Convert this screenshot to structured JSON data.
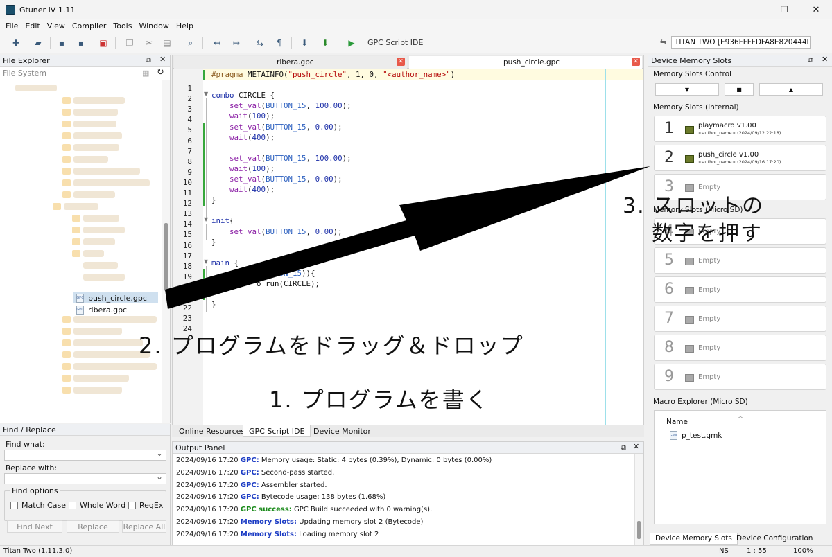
{
  "window": {
    "title": "Gtuner IV 1.11",
    "controls": [
      "—",
      "☐",
      "✕"
    ]
  },
  "menu": [
    "File",
    "Edit",
    "View",
    "Compiler",
    "Tools",
    "Window",
    "Help"
  ],
  "toolbar": {
    "gpc_ide_label": "GPC Script IDE",
    "device": "TITAN TWO [E936FFFFDFA8E820444D"
  },
  "file_explorer": {
    "title": "File Explorer",
    "filesystem_label": "File System",
    "files": [
      {
        "name": "push_circle.gpc",
        "selected": true
      },
      {
        "name": "ribera.gpc",
        "selected": false
      }
    ]
  },
  "find_replace": {
    "title": "Find / Replace",
    "find_what": "Find what:",
    "replace_with": "Replace with:",
    "options_title": "Find options",
    "options": [
      "Match Case",
      "Whole Word",
      "RegEx"
    ],
    "buttons": [
      "Find Next",
      "Replace",
      "Replace All"
    ]
  },
  "editor": {
    "tabs": [
      {
        "name": "ribera.gpc",
        "active": false
      },
      {
        "name": "push_circle.gpc",
        "active": true
      }
    ],
    "lines": [
      {
        "n": "1",
        "code": "#pragma METAINFO(\"push_circle\", 1, 0, \"<author_name>\")"
      },
      {
        "n": "2",
        "code": ""
      },
      {
        "n": "3",
        "code": "combo CIRCLE {"
      },
      {
        "n": "4",
        "code": "    set_val(BUTTON_15, 100.00);"
      },
      {
        "n": "5",
        "code": "    wait(100);"
      },
      {
        "n": "6",
        "code": "    set_val(BUTTON_15, 0.00);"
      },
      {
        "n": "7",
        "code": "    wait(400);"
      },
      {
        "n": "8",
        "code": ""
      },
      {
        "n": "9",
        "code": "    set_val(BUTTON_15, 100.00);"
      },
      {
        "n": "10",
        "code": "    wait(100);"
      },
      {
        "n": "11",
        "code": "    set_val(BUTTON_15, 0.00);"
      },
      {
        "n": "12",
        "code": "    wait(400);"
      },
      {
        "n": "13",
        "code": "}"
      },
      {
        "n": "14",
        "code": ""
      },
      {
        "n": "15",
        "code": "init{"
      },
      {
        "n": "16",
        "code": "    set_val(BUTTON_15, 0.00);"
      },
      {
        "n": "17",
        "code": "}"
      },
      {
        "n": "18",
        "code": ""
      },
      {
        "n": "19",
        "code": "main {"
      },
      {
        "n": "20",
        "code": "          (BUTTON_15)){"
      },
      {
        "n": "21",
        "code": "          o_run(CIRCLE);"
      },
      {
        "n": "22",
        "code": ""
      },
      {
        "n": "23",
        "code": "}"
      },
      {
        "n": "24",
        "code": ""
      }
    ],
    "bottom_tabs": [
      {
        "name": "Online Resources",
        "active": false
      },
      {
        "name": "GPC Script IDE",
        "active": true
      },
      {
        "name": "Device Monitor",
        "active": false
      }
    ]
  },
  "output": {
    "title": "Output Panel",
    "lines": [
      {
        "ts": "2024/09/16 17:20",
        "tag": "GPC:",
        "kind": "tag",
        "msg": "Memory usage: Static: 4 bytes (0.39%), Dynamic: 0 bytes (0.00%)"
      },
      {
        "ts": "2024/09/16 17:20",
        "tag": "GPC:",
        "kind": "tag",
        "msg": "Second-pass started."
      },
      {
        "ts": "2024/09/16 17:20",
        "tag": "GPC:",
        "kind": "tag",
        "msg": "Assembler started."
      },
      {
        "ts": "2024/09/16 17:20",
        "tag": "GPC:",
        "kind": "tag",
        "msg": "Bytecode usage: 138 bytes (1.68%)"
      },
      {
        "ts": "2024/09/16 17:20",
        "tag": "GPC success:",
        "kind": "ok",
        "msg": "GPC Build succeeded with 0 warning(s)."
      },
      {
        "ts": "2024/09/16 17:20",
        "tag": "Memory Slots:",
        "kind": "tag",
        "msg": "Updating memory slot 2 (Bytecode)"
      },
      {
        "ts": "2024/09/16 17:20",
        "tag": "Memory Slots:",
        "kind": "tag",
        "msg": "Loading memory slot 2"
      }
    ]
  },
  "device_memory": {
    "title": "Device Memory Slots",
    "control_label": "Memory Slots Control",
    "control_buttons": [
      "▼",
      "■",
      "▲"
    ],
    "internal_label": "Memory Slots (Internal)",
    "microsd_label": "Memory Slots (Micro SD)",
    "slots": [
      {
        "n": "1",
        "name": "playmacro v1.00",
        "meta": "<author_name> (2024/09/12 22:18)",
        "empty": false
      },
      {
        "n": "2",
        "name": "push_circle v1.00",
        "meta": "<author_name> (2024/09/16 17:20)",
        "empty": false
      },
      {
        "n": "3",
        "name": "Empty",
        "meta": "",
        "empty": true
      },
      {
        "n": "4",
        "name": "Empty",
        "meta": "",
        "empty": true
      },
      {
        "n": "5",
        "name": "Empty",
        "meta": "",
        "empty": true
      },
      {
        "n": "6",
        "name": "Empty",
        "meta": "",
        "empty": true
      },
      {
        "n": "7",
        "name": "Empty",
        "meta": "",
        "empty": true
      },
      {
        "n": "8",
        "name": "Empty",
        "meta": "",
        "empty": true
      },
      {
        "n": "9",
        "name": "Empty",
        "meta": "",
        "empty": true
      }
    ],
    "macro_label": "Macro Explorer (Micro SD)",
    "macro_column": "Name",
    "macro_files": [
      "p_test.gmk"
    ],
    "tabs": [
      {
        "name": "Device Memory Slots",
        "active": true
      },
      {
        "name": "Device Configuration",
        "active": false
      }
    ]
  },
  "status": {
    "app": "Titan Two (1.11.3.0)",
    "mode": "INS",
    "pos": "1 : 55",
    "zoom": "100%"
  },
  "annotations": {
    "step1": "1. プログラムを書く",
    "step2": "2. プログラムをドラッグ＆ドロップ",
    "step3_line1": "3. スロットの",
    "step3_line2": "数字を押す"
  }
}
